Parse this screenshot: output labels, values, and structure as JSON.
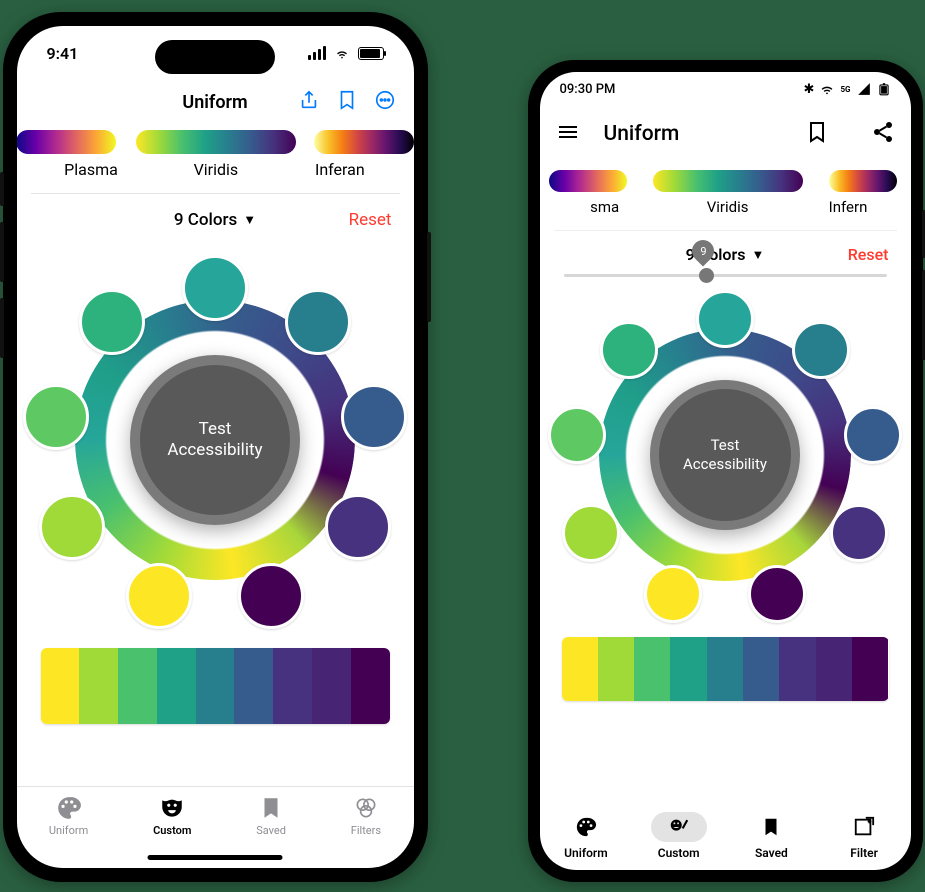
{
  "ios": {
    "status": {
      "time": "9:41"
    },
    "nav": {
      "title": "Uniform"
    },
    "gradients": [
      {
        "id": "plasma",
        "label": "Plasma"
      },
      {
        "id": "viridis",
        "label": "Viridis"
      },
      {
        "id": "inferno",
        "label": "Inferan"
      }
    ],
    "controls": {
      "count_label": "9 Colors",
      "reset_label": "Reset"
    },
    "center_button": "Test\nAccessibility",
    "palette_colors": [
      "#fde725",
      "#a0da39",
      "#4ac16d",
      "#1fa187",
      "#277f8e",
      "#365c8d",
      "#46327e",
      "#482475",
      "#440154"
    ],
    "wheel_colors": [
      "#26a69a",
      "#277f8e",
      "#365c8d",
      "#46327e",
      "#440154",
      "#fde725",
      "#a0da39",
      "#5ec962",
      "#2db27d"
    ],
    "tabs": [
      {
        "id": "uniform",
        "label": "Uniform"
      },
      {
        "id": "custom",
        "label": "Custom",
        "active": true
      },
      {
        "id": "saved",
        "label": "Saved"
      },
      {
        "id": "filters",
        "label": "Filters"
      }
    ]
  },
  "android": {
    "status": {
      "time": "09:30 PM"
    },
    "appbar": {
      "title": "Uniform"
    },
    "gradients": [
      {
        "id": "plasma",
        "label": "sma"
      },
      {
        "id": "viridis",
        "label": "Viridis"
      },
      {
        "id": "inferno",
        "label": "Infern"
      }
    ],
    "controls": {
      "count_label": "9 Colors",
      "reset_label": "Reset",
      "slider_value": "9"
    },
    "center_button": "Test\nAccessibility",
    "palette_colors": [
      "#fde725",
      "#a0da39",
      "#4ac16d",
      "#1fa187",
      "#277f8e",
      "#365c8d",
      "#46327e",
      "#482475",
      "#440154"
    ],
    "wheel_colors": [
      "#26a69a",
      "#277f8e",
      "#365c8d",
      "#46327e",
      "#440154",
      "#fde725",
      "#a0da39",
      "#5ec962",
      "#2db27d"
    ],
    "tabs": [
      {
        "id": "uniform",
        "label": "Uniform"
      },
      {
        "id": "custom",
        "label": "Custom",
        "active": true
      },
      {
        "id": "saved",
        "label": "Saved"
      },
      {
        "id": "filter",
        "label": "Filter"
      }
    ]
  }
}
